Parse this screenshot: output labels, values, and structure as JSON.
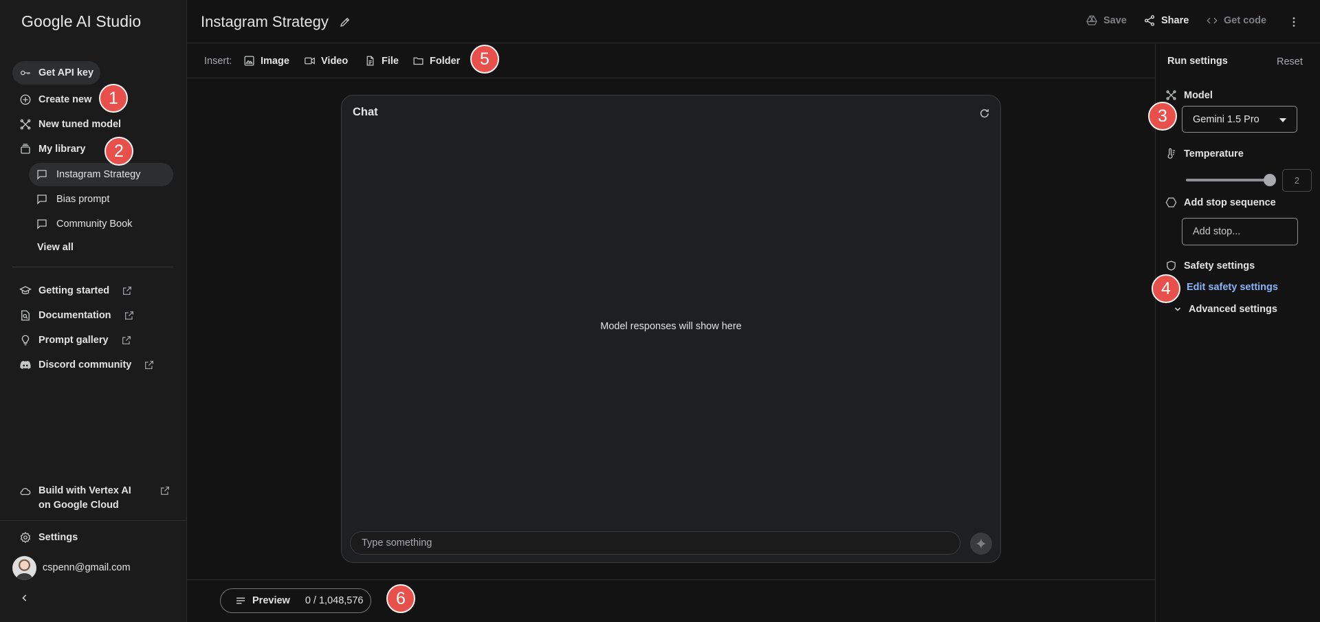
{
  "app": {
    "brand": "Google AI Studio"
  },
  "sidebar": {
    "get_api_key": "Get API key",
    "create_new": "Create new",
    "new_tuned_model": "New tuned model",
    "my_library": "My library",
    "library_items": [
      {
        "label": "Instagram Strategy",
        "active": true
      },
      {
        "label": "Bias prompt",
        "active": false
      },
      {
        "label": "Community Book",
        "active": false
      }
    ],
    "view_all": "View all",
    "resources": [
      {
        "label": "Getting started",
        "icon": "school-icon"
      },
      {
        "label": "Documentation",
        "icon": "document-search-icon"
      },
      {
        "label": "Prompt gallery",
        "icon": "lightbulb-icon"
      },
      {
        "label": "Discord community",
        "icon": "discord-icon"
      }
    ],
    "vertex": "Build with Vertex AI on Google Cloud",
    "settings": "Settings",
    "user_email": "cspenn@gmail.com"
  },
  "header": {
    "title": "Instagram Strategy",
    "save": "Save",
    "share": "Share",
    "get_code": "Get code"
  },
  "insert_bar": {
    "label": "Insert:",
    "image": "Image",
    "video": "Video",
    "file": "File",
    "folder": "Folder"
  },
  "chat": {
    "title": "Chat",
    "empty_message": "Model responses will show here",
    "input_placeholder": "Type something"
  },
  "bottom": {
    "preview": "Preview",
    "token_count": "0 / 1,048,576"
  },
  "run_settings": {
    "title": "Run settings",
    "reset": "Reset",
    "model_label": "Model",
    "model_value": "Gemini 1.5 Pro",
    "temperature_label": "Temperature",
    "temperature_value": "2",
    "temperature_fraction": 1.0,
    "stop_sequence_label": "Add stop sequence",
    "stop_placeholder": "Add stop...",
    "safety_label": "Safety settings",
    "edit_safety": "Edit safety settings",
    "advanced": "Advanced settings"
  },
  "callouts": [
    "1",
    "2",
    "3",
    "4",
    "5",
    "6"
  ],
  "colors": {
    "background": "#131314",
    "sidebar": "#1b1b1c",
    "panel": "#1e1f20",
    "link": "#8ab4f8",
    "callout": "#e8504b"
  }
}
